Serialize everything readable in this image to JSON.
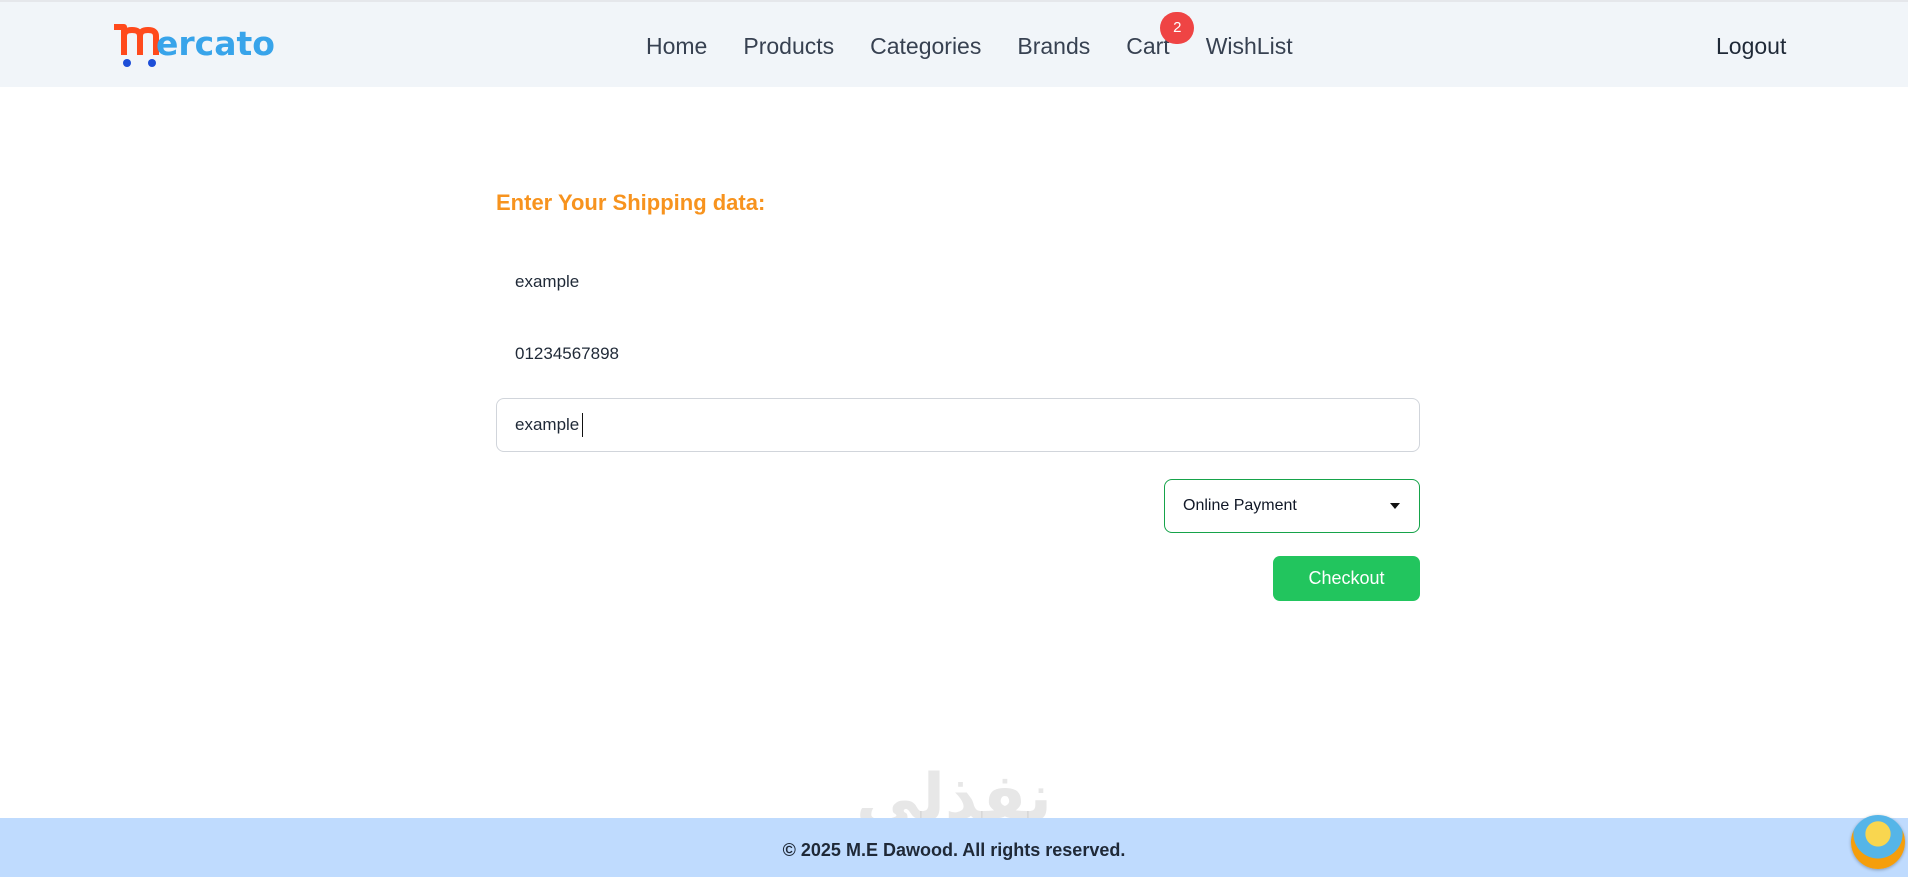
{
  "brand": {
    "logo_text": "ercato"
  },
  "nav": {
    "links": [
      "Home",
      "Products",
      "Categories",
      "Brands",
      "Cart",
      "WishList"
    ],
    "cart_count": "2",
    "logout": "Logout"
  },
  "form": {
    "title": "Enter Your Shipping data:",
    "details_value": "example",
    "phone_value": "01234567898",
    "city_value": "example",
    "payment_selected": "Online Payment",
    "checkout_label": "Checkout"
  },
  "footer": {
    "text": "© 2025 M.E Dawood. All rights reserved."
  },
  "watermark": {
    "text": "نفذلي"
  },
  "colors": {
    "accent_orange": "#f7931e",
    "checkout_green": "#22c55e",
    "badge_red": "#ef4444",
    "logo_blue": "#38a4ea",
    "footer_blue": "#bfdbfe"
  }
}
